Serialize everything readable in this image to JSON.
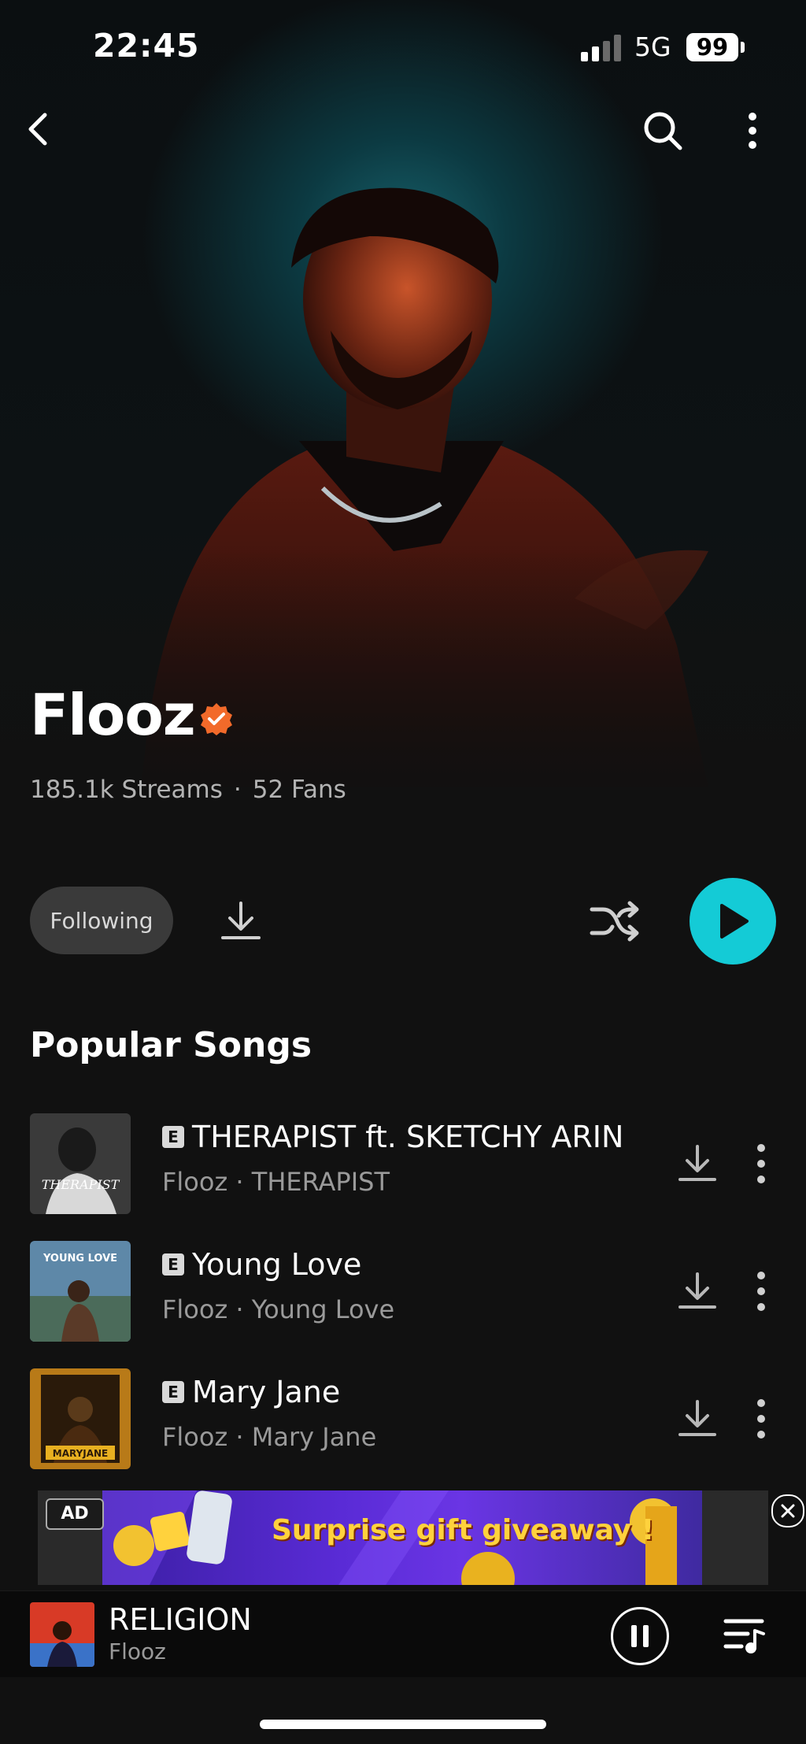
{
  "status_bar": {
    "time": "22:45",
    "network": "5G",
    "battery": "99"
  },
  "artist": {
    "name": "Flooz",
    "streams": "185.1k Streams",
    "separator": "·",
    "fans": "52 Fans"
  },
  "actions": {
    "following_label": "Following"
  },
  "popular": {
    "title": "Popular Songs",
    "explicit_badge": "E",
    "songs": [
      {
        "title": "THERAPIST ft. SKETCHY ARIN",
        "subtitle": "Flooz · THERAPIST"
      },
      {
        "title": "Young Love",
        "subtitle": "Flooz · Young Love"
      },
      {
        "title": "Mary Jane",
        "subtitle": "Flooz · Mary Jane"
      }
    ]
  },
  "ad": {
    "label": "AD",
    "text": "Surprise gift giveaway !"
  },
  "now_playing": {
    "title": "RELIGION",
    "artist": "Flooz"
  },
  "colors": {
    "accent": "#14cbd6",
    "verified": "#f26a2a",
    "background": "#111111"
  }
}
